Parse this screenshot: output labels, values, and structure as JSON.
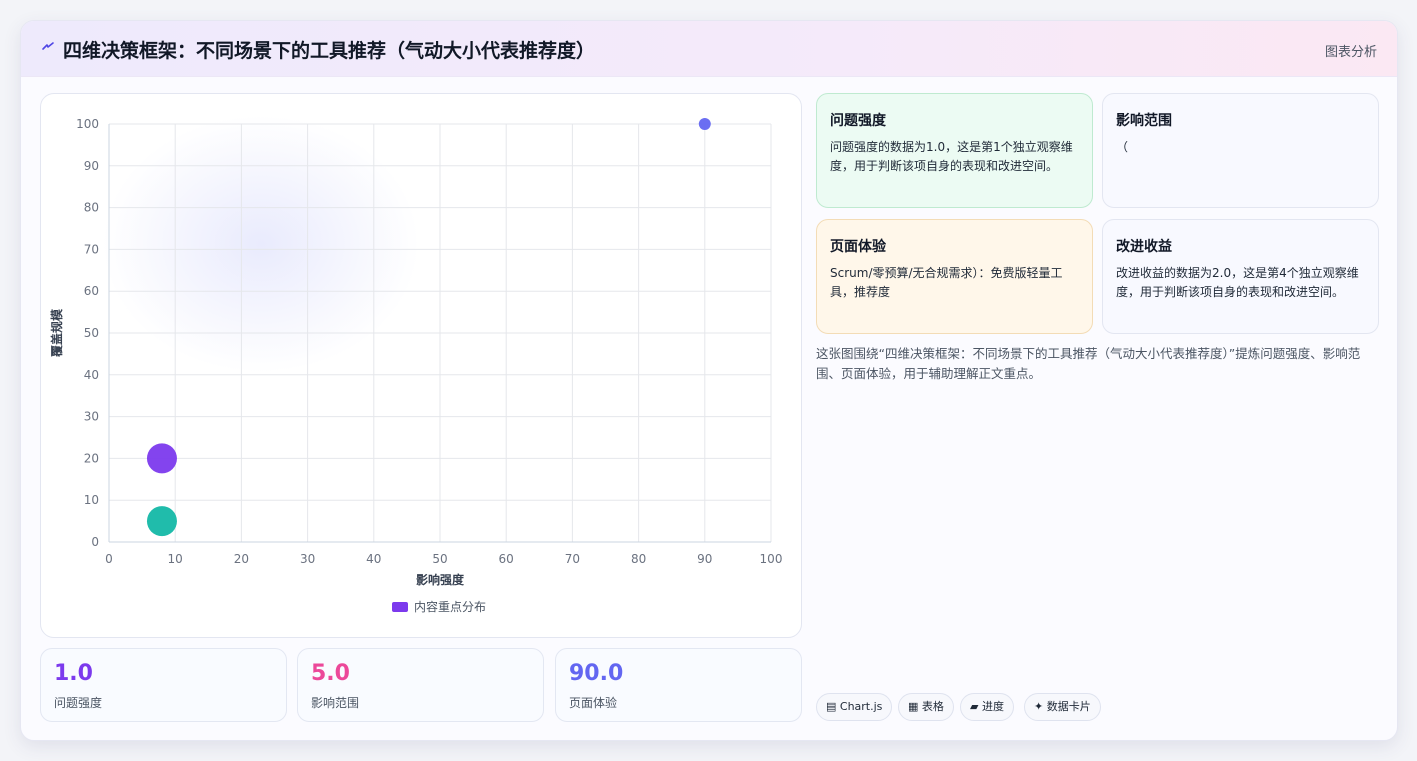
{
  "header": {
    "title": "四维决策框架：不同场景下的工具推荐（气动大小代表推荐度）",
    "action": "图表分析",
    "icon": "lightning-icon",
    "icon_char": "⌁"
  },
  "chart_data": {
    "type": "bubble",
    "title": "",
    "xlabel": "影响强度",
    "ylabel": "覆盖规模",
    "xlim": [
      0,
      100
    ],
    "ylim": [
      0,
      100
    ],
    "x_ticks": [
      0,
      10,
      20,
      30,
      40,
      50,
      60,
      70,
      80,
      90,
      100
    ],
    "y_ticks": [
      0,
      10,
      20,
      30,
      40,
      50,
      60,
      70,
      80,
      90,
      100
    ],
    "grid": true,
    "legend": {
      "position": "bottom",
      "label": "内容重点分布",
      "color": "#7c3aed"
    },
    "points": [
      {
        "x": 8,
        "y": 5,
        "r": 15,
        "color": "#14b8a6"
      },
      {
        "x": 8,
        "y": 20,
        "r": 15,
        "color": "#7c3aed"
      },
      {
        "x": 90,
        "y": 100,
        "r": 6,
        "color": "#6366f1"
      }
    ]
  },
  "stats": [
    {
      "value": "1.0",
      "label": "问题强度",
      "color": "#7c3aed"
    },
    {
      "value": "5.0",
      "label": "影响范围",
      "color": "#ec4899"
    },
    {
      "value": "90.0",
      "label": "页面体验",
      "color": "#6366f1"
    }
  ],
  "cards": [
    {
      "title": "问题强度",
      "body": "问题强度的数据为1.0，这是第1个独立观察维度，用于判断该项自身的表现和改进空间。"
    },
    {
      "title": "影响范围",
      "body": "（"
    },
    {
      "title": "页面体验",
      "body": "Scrum/零预算/无合规需求）：免费版轻量工具，推荐度"
    },
    {
      "title": "改进收益",
      "body": "改进收益的数据为2.0，这是第4个独立观察维度，用于判断该项自身的表现和改进空间。"
    }
  ],
  "summary": "这张图围绕“四维决策框架：不同场景下的工具推荐（气动大小代表推荐度）”提炼问题强度、影响范围、页面体验，用于辅助理解正文重点。",
  "tags": [
    "▤ Chart.js",
    "▦ 表格",
    "▰ 进度",
    "✦ 数据卡片"
  ]
}
